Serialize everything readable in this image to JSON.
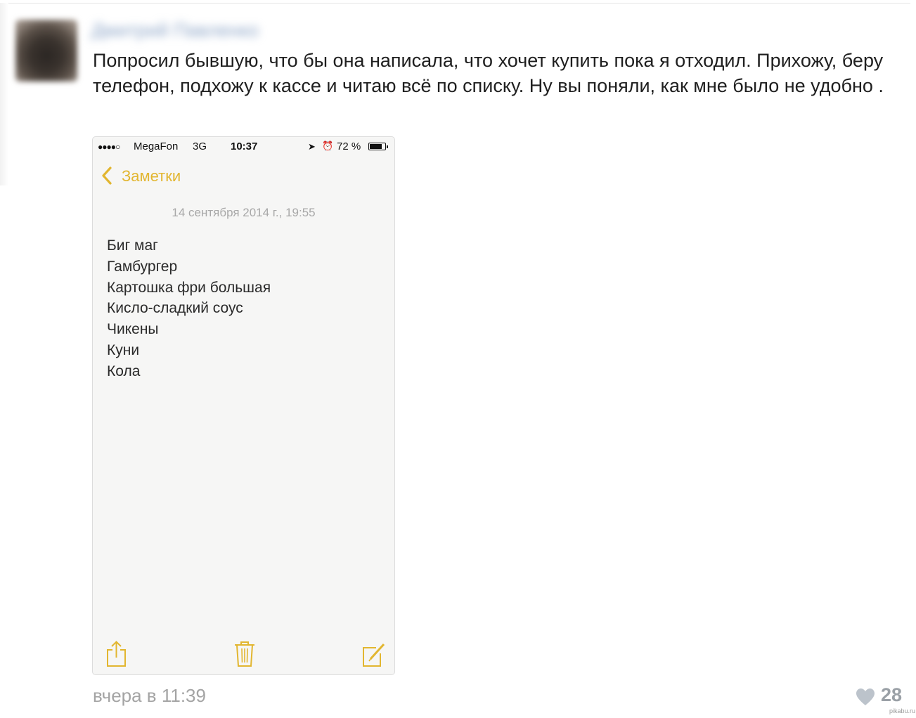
{
  "post": {
    "author_name": "Дмитрий Павленко",
    "text": "Попросил бывшую, что бы она написала, что хочет купить пока я отходил. Прихожу, беру телефон, подхожу к кассе и читаю всё по списку. Ну вы поняли, как мне было не удобно .",
    "timestamp": "вчера в 11:39",
    "likes": "28"
  },
  "phone": {
    "status_bar": {
      "signal": "●●●●○",
      "carrier": "MegaFon",
      "network": "3G",
      "time": "10:37",
      "battery": "72 %"
    },
    "back_label": "Заметки",
    "note_date": "14 сентября 2014 г., 19:55",
    "note_items": [
      "Биг маг",
      "Гамбургер",
      "Картошка фри большая",
      "Кисло-сладкий соус",
      "Чикены",
      "Куни",
      "Кола"
    ]
  },
  "watermark": "pikabu.ru",
  "colors": {
    "accent": "#e2b630",
    "note_background": "#f6f6f5",
    "timestamp": "#a4a4a4",
    "like": "#9aa0a6"
  },
  "icons": [
    "chevron-left-icon",
    "share-icon",
    "trash-icon",
    "compose-icon",
    "heart-icon",
    "location-arrow-icon",
    "alarm-icon",
    "battery-icon"
  ]
}
